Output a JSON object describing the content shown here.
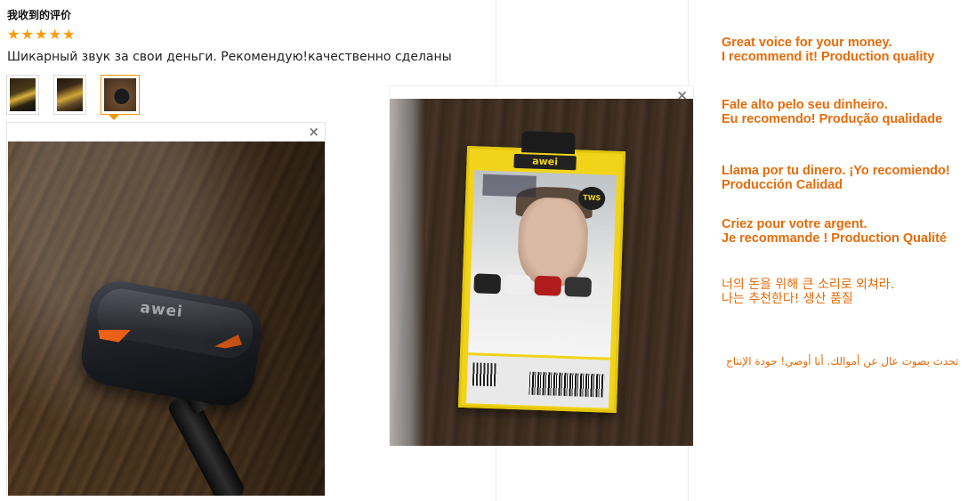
{
  "review": {
    "title": "我收到的评价",
    "rating": 5,
    "stars": [
      "★",
      "★",
      "★",
      "★",
      "★"
    ],
    "text": "Шикарный звук за свои деньги. Рекомендую!качественно сделаны",
    "thumbnails_count": 3,
    "active_thumbnail": 3
  },
  "viewer_left": {
    "close_label": "×"
  },
  "viewer_right": {
    "close_label": "×"
  },
  "translations": [
    {
      "line1": "Great voice for your money.",
      "line2": "I recommend it! Production quality"
    },
    {
      "line1": "Fale alto pelo seu dinheiro.",
      "line2": "Eu recomendo! Produção qualidade"
    },
    {
      "line1": "Llama por tu dinero. ¡Yo recomiendo!",
      "line2": "Producción Calidad"
    },
    {
      "line1": "Criez pour votre argent.",
      "line2": "Je recommande ! Production Qualité"
    },
    {
      "line1": "너의 돈을 위해 큰 소리로 외쳐라.",
      "line2": "나는 추천한다! 생산 품질"
    },
    {
      "line1": "تحدث بصوت عال عن أموالك. أنا أوصي! جودة الإنتاج",
      "line2": ""
    }
  ],
  "colors": {
    "accent": "#e46c0a",
    "stars": "#ff9a00",
    "active_border": "#f39800"
  },
  "icons": {
    "close": "close-icon",
    "star": "star-icon"
  }
}
